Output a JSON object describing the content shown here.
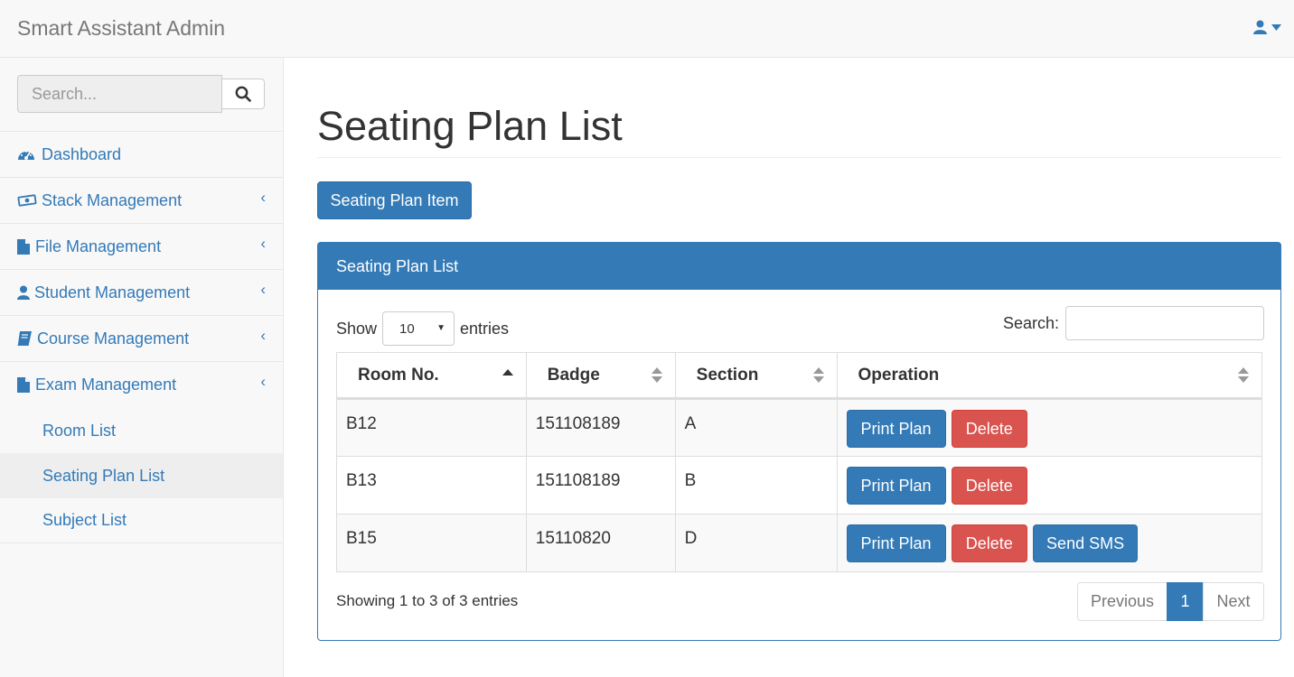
{
  "app": {
    "brand": "Smart Assistant Admin"
  },
  "sidebar": {
    "search_placeholder": "Search...",
    "items": [
      {
        "label": "Dashboard",
        "icon": "dashboard-icon"
      },
      {
        "label": "Stack Management",
        "icon": "money-icon"
      },
      {
        "label": "File Management",
        "icon": "file-icon"
      },
      {
        "label": "Student Management",
        "icon": "user-icon"
      },
      {
        "label": "Course Management",
        "icon": "book-icon"
      },
      {
        "label": "Exam Management",
        "icon": "file-icon"
      }
    ],
    "sub_items": [
      {
        "label": "Room List"
      },
      {
        "label": "Seating Plan List",
        "active": true
      },
      {
        "label": "Subject List"
      }
    ]
  },
  "main": {
    "title": "Seating Plan List",
    "add_button": "Seating Plan Item",
    "panel_title": "Seating Plan List",
    "length": {
      "show": "Show",
      "value": "10",
      "entries": "entries"
    },
    "filter_label": "Search:",
    "columns": [
      "Room No.",
      "Badge",
      "Section",
      "Operation"
    ],
    "rows": [
      {
        "room": "B12",
        "badge": "151108189",
        "section": "A",
        "actions": [
          "Print Plan",
          "Delete"
        ]
      },
      {
        "room": "B13",
        "badge": "151108189",
        "section": "B",
        "actions": [
          "Print Plan",
          "Delete"
        ]
      },
      {
        "room": "B15",
        "badge": "15110820",
        "section": "D",
        "actions": [
          "Print Plan",
          "Delete",
          "Send SMS"
        ]
      }
    ],
    "info": "Showing 1 to 3 of 3 entries",
    "pagination": {
      "previous": "Previous",
      "current": "1",
      "next": "Next"
    }
  },
  "colors": {
    "primary": "#337ab7",
    "danger": "#d9534f",
    "navbar_bg": "#f8f8f8"
  }
}
